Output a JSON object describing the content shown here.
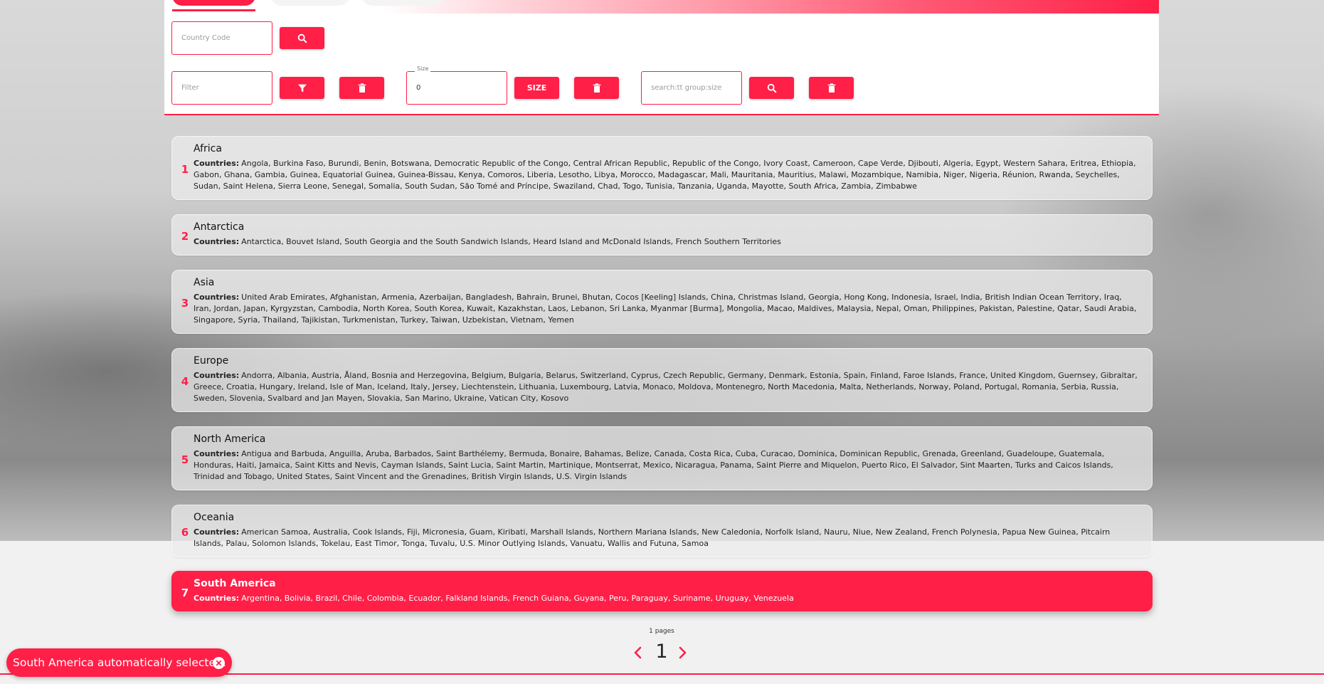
{
  "search_country": {
    "placeholder": "Country Code"
  },
  "filter": {
    "placeholder": "Filter"
  },
  "size": {
    "label": "Size",
    "value": "0",
    "button_label": "SIZE"
  },
  "search_query": {
    "placeholder": "search:tt group:size"
  },
  "colors": {
    "accent": "#ff1f47",
    "panel": "#ffffff"
  },
  "icons": {
    "search": "search-icon",
    "filter": "filter-icon",
    "delete": "trash-icon",
    "prev": "chevron-left-icon",
    "next": "chevron-right-icon",
    "close": "close-circle-icon"
  },
  "continents": [
    {
      "index": "1",
      "name": "Africa",
      "label": "Countries:",
      "countries": "Angola, Burkina Faso, Burundi, Benin, Botswana, Democratic Republic of the Congo, Central African Republic, Republic of the Congo, Ivory Coast, Cameroon, Cape Verde, Djibouti, Algeria, Egypt, Western Sahara, Eritrea, Ethiopia, Gabon, Ghana, Gambia, Guinea, Equatorial Guinea, Guinea-Bissau, Kenya, Comoros, Liberia, Lesotho, Libya, Morocco, Madagascar, Mali, Mauritania, Mauritius, Malawi, Mozambique, Namibia, Niger, Nigeria, Réunion, Rwanda, Seychelles, Sudan, Saint Helena, Sierra Leone, Senegal, Somalia, South Sudan, São Tomé and Príncipe, Swaziland, Chad, Togo, Tunisia, Tanzania, Uganda, Mayotte, South Africa, Zambia, Zimbabwe"
    },
    {
      "index": "2",
      "name": "Antarctica",
      "label": "Countries:",
      "countries": "Antarctica, Bouvet Island, South Georgia and the South Sandwich Islands, Heard Island and McDonald Islands, French Southern Territories"
    },
    {
      "index": "3",
      "name": "Asia",
      "label": "Countries:",
      "countries": "United Arab Emirates, Afghanistan, Armenia, Azerbaijan, Bangladesh, Bahrain, Brunei, Bhutan, Cocos [Keeling] Islands, China, Christmas Island, Georgia, Hong Kong, Indonesia, Israel, India, British Indian Ocean Territory, Iraq, Iran, Jordan, Japan, Kyrgyzstan, Cambodia, North Korea, South Korea, Kuwait, Kazakhstan, Laos, Lebanon, Sri Lanka, Myanmar [Burma], Mongolia, Macao, Maldives, Malaysia, Nepal, Oman, Philippines, Pakistan, Palestine, Qatar, Saudi Arabia, Singapore, Syria, Thailand, Tajikistan, Turkmenistan, Turkey, Taiwan, Uzbekistan, Vietnam, Yemen"
    },
    {
      "index": "4",
      "name": "Europe",
      "label": "Countries:",
      "countries": "Andorra, Albania, Austria, Åland, Bosnia and Herzegovina, Belgium, Bulgaria, Belarus, Switzerland, Cyprus, Czech Republic, Germany, Denmark, Estonia, Spain, Finland, Faroe Islands, France, United Kingdom, Guernsey, Gibraltar, Greece, Croatia, Hungary, Ireland, Isle of Man, Iceland, Italy, Jersey, Liechtenstein, Lithuania, Luxembourg, Latvia, Monaco, Moldova, Montenegro, North Macedonia, Malta, Netherlands, Norway, Poland, Portugal, Romania, Serbia, Russia, Sweden, Slovenia, Svalbard and Jan Mayen, Slovakia, San Marino, Ukraine, Vatican City, Kosovo"
    },
    {
      "index": "5",
      "name": "North America",
      "label": "Countries:",
      "countries": "Antigua and Barbuda, Anguilla, Aruba, Barbados, Saint Barthélemy, Bermuda, Bonaire, Bahamas, Belize, Canada, Costa Rica, Cuba, Curacao, Dominica, Dominican Republic, Grenada, Greenland, Guadeloupe, Guatemala, Honduras, Haiti, Jamaica, Saint Kitts and Nevis, Cayman Islands, Saint Lucia, Saint Martin, Martinique, Montserrat, Mexico, Nicaragua, Panama, Saint Pierre and Miquelon, Puerto Rico, El Salvador, Sint Maarten, Turks and Caicos Islands, Trinidad and Tobago, United States, Saint Vincent and the Grenadines, British Virgin Islands, U.S. Virgin Islands"
    },
    {
      "index": "6",
      "name": "Oceania",
      "label": "Countries:",
      "countries": "American Samoa, Australia, Cook Islands, Fiji, Micronesia, Guam, Kiribati, Marshall Islands, Northern Mariana Islands, New Caledonia, Norfolk Island, Nauru, Niue, New Zealand, French Polynesia, Papua New Guinea, Pitcairn Islands, Palau, Solomon Islands, Tokelau, East Timor, Tonga, Tuvalu, U.S. Minor Outlying Islands, Vanuatu, Wallis and Futuna, Samoa"
    },
    {
      "index": "7",
      "name": "South America",
      "label": "Countries:",
      "countries": "Argentina, Bolivia, Brazil, Chile, Colombia, Ecuador, Falkland Islands, French Guiana, Guyana, Peru, Paraguay, Suriname, Uruguay, Venezuela",
      "selected": true
    }
  ],
  "pagination": {
    "pages_label": "1 pages",
    "current_page": "1"
  },
  "toast": {
    "message": "South America automatically selected."
  }
}
